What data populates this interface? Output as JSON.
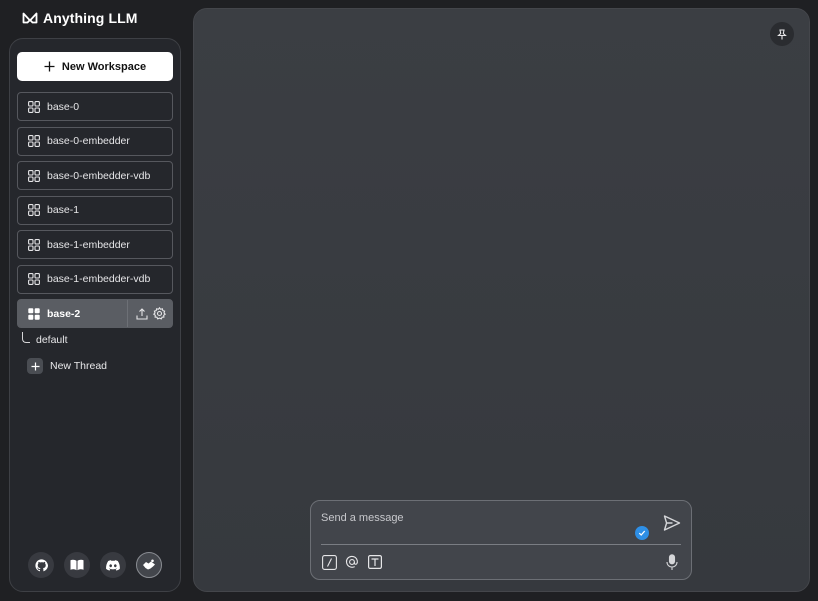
{
  "app": {
    "logo_text": "Anything LLM"
  },
  "sidebar": {
    "new_workspace_label": "New Workspace",
    "workspaces": [
      {
        "label": "base-0"
      },
      {
        "label": "base-0-embedder"
      },
      {
        "label": "base-0-embedder-vdb"
      },
      {
        "label": "base-1"
      },
      {
        "label": "base-1-embedder"
      },
      {
        "label": "base-1-embedder-vdb"
      },
      {
        "label": "base-2",
        "active": true
      }
    ],
    "threads": [
      {
        "label": "default"
      }
    ],
    "new_thread_label": "New Thread",
    "footer_icons": [
      "github-icon",
      "docs-book-icon",
      "discord-icon",
      "community-hub-icon"
    ]
  },
  "chat": {
    "input": {
      "placeholder": "Send a message",
      "value": ""
    },
    "tools": [
      "slash-command-icon",
      "at-mention-icon",
      "text-format-icon",
      "microphone-icon"
    ]
  },
  "colors": {
    "background": "#1f2023",
    "sidebar": "#25272c",
    "main_panel": "#3a3d42",
    "active_workspace": "#5a5d63",
    "accent_blue": "#2e8fe6"
  }
}
